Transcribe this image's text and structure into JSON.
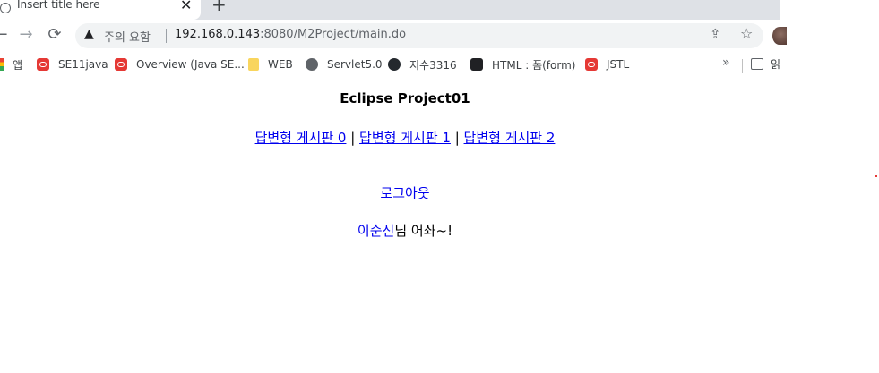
{
  "browser": {
    "tab": {
      "title": "Insert title here",
      "close_label": "✕"
    },
    "new_tab_label": "+",
    "toolbar": {
      "back_label": "←",
      "forward_label": "→",
      "reload_label": "⟳",
      "security_text": "주의 요함",
      "url_host": "192.168.0.143",
      "url_rest": ":8080/M2Project/main.do"
    },
    "bookmarks": [
      {
        "label": "앱",
        "icon": "apps-icon"
      },
      {
        "label": "SE11java",
        "icon": "oracle-icon"
      },
      {
        "label": "Overview (Java SE...",
        "icon": "oracle-icon"
      },
      {
        "label": "WEB",
        "icon": "folder-icon"
      },
      {
        "label": "Servlet5.0",
        "icon": "globe-icon"
      },
      {
        "label": "지수3316",
        "icon": "github-icon"
      },
      {
        "label": "HTML : 폼(form)",
        "icon": "doc-icon"
      },
      {
        "label": "JSTL",
        "icon": "oracle-icon"
      }
    ],
    "bookmarks_more": "»",
    "reading_list_label": "읽"
  },
  "page": {
    "title": "Eclipse Project01",
    "boards": [
      {
        "label": "답변형 게시판 0"
      },
      {
        "label": "답변형 게시판 1"
      },
      {
        "label": "답변형 게시판 2"
      }
    ],
    "separator": " | ",
    "logout_label": "로그아웃",
    "welcome_name": "이순신",
    "welcome_suffix": "님 어솨~!"
  }
}
